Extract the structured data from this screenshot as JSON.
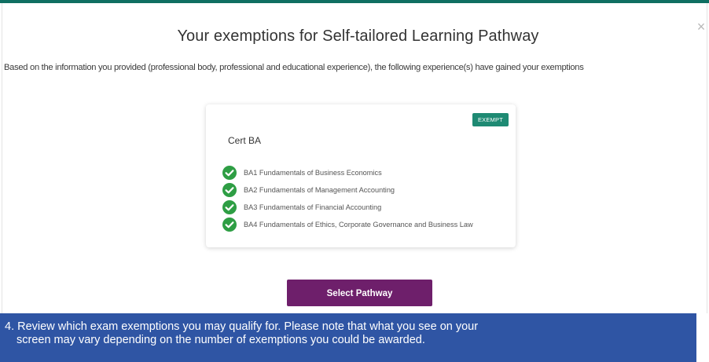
{
  "modal": {
    "title": "Your exemptions for Self-tailored Learning Pathway",
    "subtitle": "Based on the information you provided (professional body, professional and educational experience), the following experience(s) have gained your exemptions",
    "close_label": "×"
  },
  "card": {
    "badge": "EXEMPT",
    "title": "Cert BA",
    "modules": [
      {
        "label": "BA1 Fundamentals of Business Economics",
        "icon": "check-circle-icon"
      },
      {
        "label": "BA2 Fundamentals of Management Accounting",
        "icon": "check-circle-icon"
      },
      {
        "label": "BA3 Fundamentals of Financial Accounting",
        "icon": "check-circle-icon"
      },
      {
        "label": "BA4 Fundamentals of Ethics, Corporate Governance and Business Law",
        "icon": "check-circle-icon"
      }
    ]
  },
  "actions": {
    "select_pathway": "Select Pathway"
  },
  "caption": {
    "line1": "4. Review which exam exemptions you may qualify for. Please note that what you see on your",
    "line2": "screen may vary depending on the number of exemptions you could be awarded."
  },
  "colors": {
    "accent_green": "#1e8a73",
    "check_green": "#2e9e44",
    "button_purple": "#6e1f6b",
    "caption_blue": "#2f55a4"
  }
}
